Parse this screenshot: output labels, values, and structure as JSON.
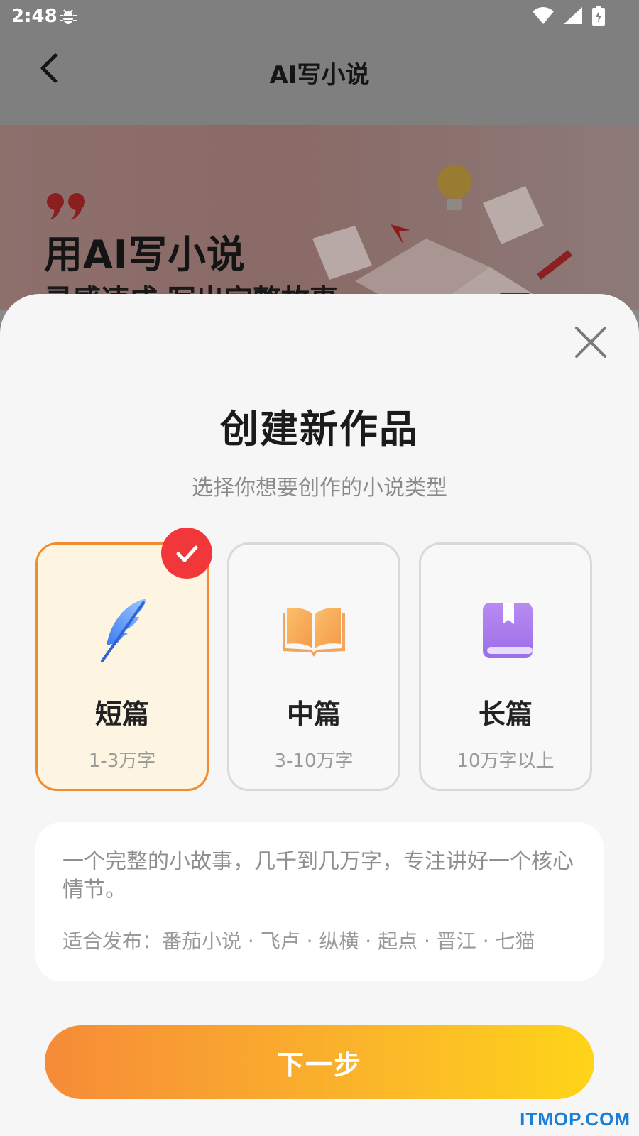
{
  "status_bar": {
    "time": "2:48"
  },
  "header": {
    "title": "AI写小说"
  },
  "banner": {
    "title": "用AI写小说",
    "subtitle": "灵感速成 写出完整故事"
  },
  "sheet": {
    "title": "创建新作品",
    "subtitle": "选择你想要创作的小说类型",
    "options": [
      {
        "label": "短篇",
        "sub": "1-3万字",
        "icon": "feather-icon",
        "selected": true
      },
      {
        "label": "中篇",
        "sub": "3-10万字",
        "icon": "open-book-icon",
        "selected": false
      },
      {
        "label": "长篇",
        "sub": "10万字以上",
        "icon": "bookmarked-book-icon",
        "selected": false
      }
    ],
    "description": "一个完整的小故事，几千到几万字，专注讲好一个核心情节。",
    "platforms": "适合发布：番茄小说 · 飞卢 · 纵横 · 起点 · 晋江 · 七猫",
    "next_label": "下一步"
  },
  "watermark": "ITMOP.COM",
  "colors": {
    "accent_orange": "#f28c2e",
    "selected_bg": "#fdf4e1",
    "check_red": "#f2373b",
    "button_gradient_start": "#f68b38",
    "button_gradient_end": "#fed418"
  }
}
